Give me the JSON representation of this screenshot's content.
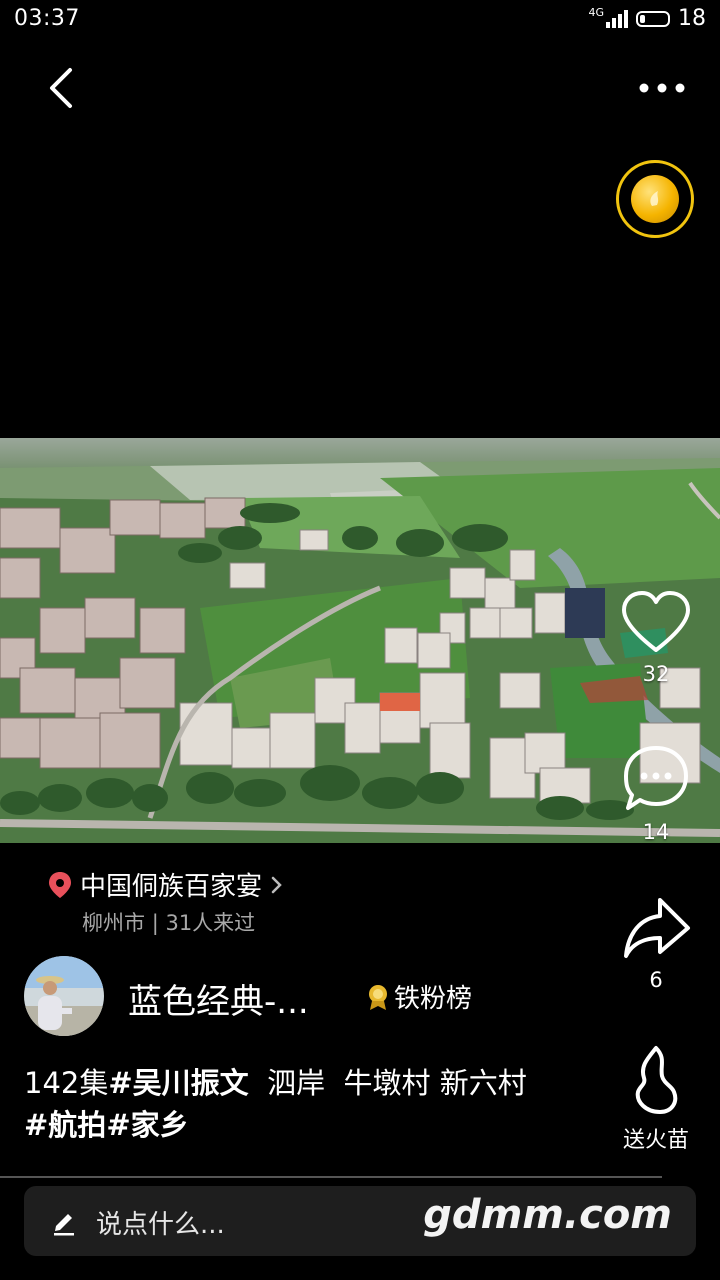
{
  "status_bar": {
    "time": "03:37",
    "network": "4G",
    "battery": "18"
  },
  "video": {
    "location_title": "中国侗族百家宴",
    "location_city": "柳州市",
    "location_visitors": "31人来过"
  },
  "actions": {
    "like_count": "32",
    "comment_count": "14",
    "share_count": "6",
    "gift_label": "送火苗"
  },
  "author": {
    "name": "蓝色经典-...",
    "fan_rank": "铁粉榜"
  },
  "caption": {
    "part1": "142集",
    "tag1": "#吴川振文",
    "part2": "  泗岸  牛墩村 新六村",
    "tag2": "#航拍",
    "tag3": "#家乡"
  },
  "comment": {
    "placeholder": "说点什么...",
    "watermark": "gdmm.com"
  },
  "icons": [
    "back-icon",
    "more-icon",
    "coin-icon",
    "heart-icon",
    "comment-icon",
    "share-icon",
    "flame-icon",
    "location-pin-icon",
    "chevron-right-icon",
    "medal-icon",
    "pencil-icon"
  ]
}
